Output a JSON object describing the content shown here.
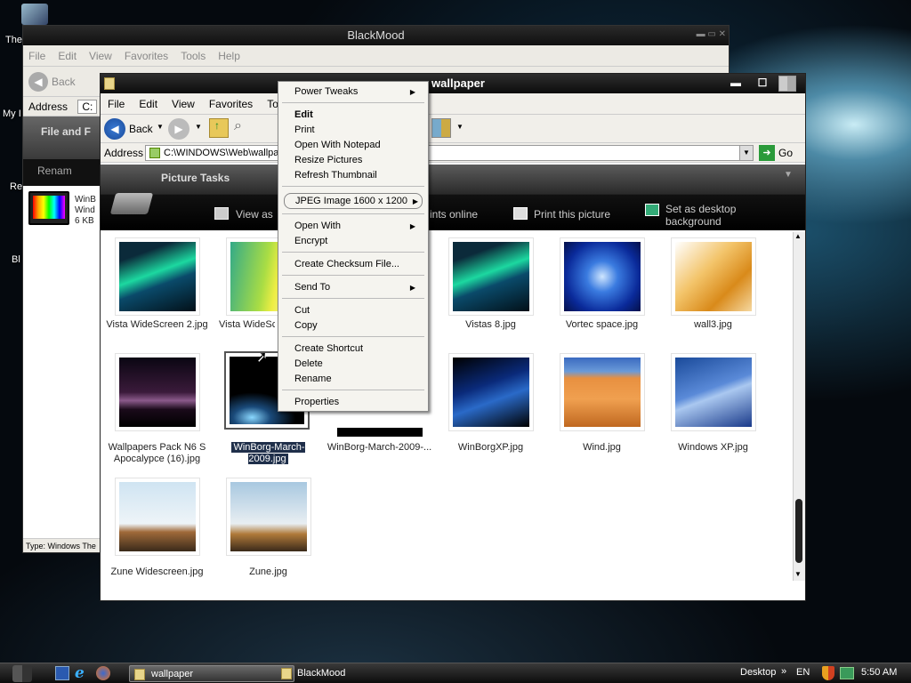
{
  "desktop": {
    "icons": [
      {
        "label": "The"
      },
      {
        "label": "My I"
      },
      {
        "label": "Re"
      },
      {
        "label": "Bl"
      }
    ]
  },
  "back_window": {
    "title": "BlackMood",
    "menu": [
      "File",
      "Edit",
      "View",
      "Favorites",
      "Tools",
      "Help"
    ],
    "back_label": "Back",
    "address_label": "Address",
    "address_value": "C:",
    "task_header": "File and F",
    "task_rename": "Renam",
    "file_info": [
      "WinB",
      "Wind",
      "6 KB"
    ],
    "status": "Type: Windows The"
  },
  "front_window": {
    "title": "wallpaper",
    "menu": [
      "File",
      "Edit",
      "View",
      "Favorites",
      "Tools"
    ],
    "back_label": "Back",
    "address_label": "Address",
    "address_value": "C:\\WINDOWS\\Web\\wallpa",
    "go_label": "Go",
    "task_header": "Picture Tasks",
    "tasks": {
      "view": "View as",
      "online": "ints online",
      "print": "Print this picture",
      "desktop1": "Set as desktop",
      "desktop2": "background"
    },
    "files": [
      {
        "name": "Vista WideScreen 2.jpg"
      },
      {
        "name": "Vista WideScr"
      },
      {
        "name": "Vistas 8.jpg"
      },
      {
        "name": "Vortec space.jpg"
      },
      {
        "name": "wall3.jpg"
      },
      {
        "name": "Wallpapers Pack N6 S Apocalypce (16).jpg"
      },
      {
        "name": "WinBorg-March-2009.jpg"
      },
      {
        "name": "WinBorg-March-2009-..."
      },
      {
        "name": "WinBorgXP.jpg"
      },
      {
        "name": "Wind.jpg"
      },
      {
        "name": "Windows XP.jpg"
      },
      {
        "name": "Zune Widescreen.jpg"
      },
      {
        "name": "Zune.jpg"
      }
    ]
  },
  "context_menu": {
    "items": [
      "Power Tweaks",
      "Edit",
      "Print",
      "Open With Notepad",
      "Resize Pictures",
      "Refresh Thumbnail",
      "JPEG Image 1600 x 1200",
      "Open With",
      "Encrypt",
      "Create Checksum File...",
      "Send To",
      "Cut",
      "Copy",
      "Create Shortcut",
      "Delete",
      "Rename",
      "Properties"
    ]
  },
  "taskbar": {
    "buttons": [
      "wallpaper",
      "BlackMood"
    ],
    "desktop_label": "Desktop",
    "chevron": "»",
    "lang": "EN",
    "time": "5:50 AM"
  }
}
